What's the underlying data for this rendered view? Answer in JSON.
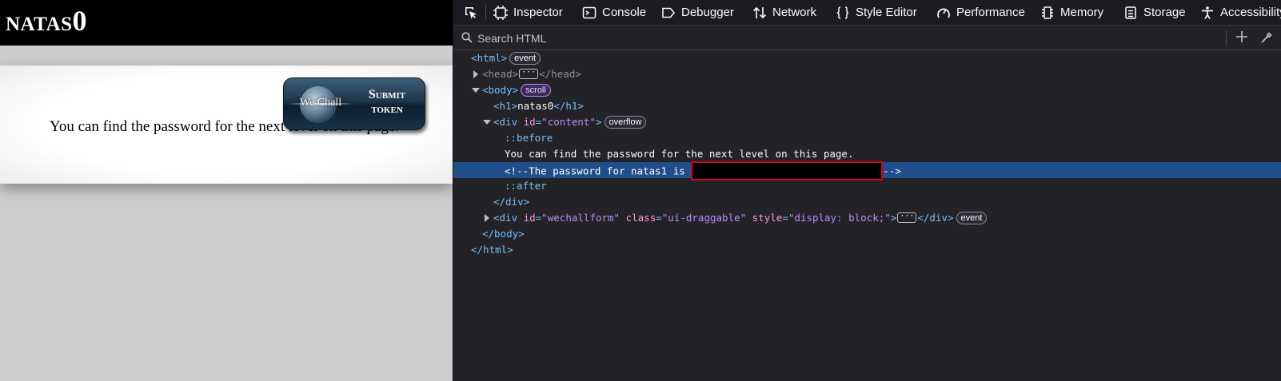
{
  "page": {
    "title": "natas0",
    "content_text": "You can find the password for the next level on this page.",
    "wechall": {
      "logo_text": "We Chall",
      "submit_line1": "Submit",
      "submit_line2": "token"
    }
  },
  "devtools": {
    "tabs": [
      {
        "label": "Inspector",
        "icon": "inspector-icon",
        "active": true
      },
      {
        "label": "Console",
        "icon": "console-icon"
      },
      {
        "label": "Debugger",
        "icon": "debugger-icon"
      },
      {
        "label": "Network",
        "icon": "network-icon"
      },
      {
        "label": "Style Editor",
        "icon": "style-editor-icon"
      },
      {
        "label": "Performance",
        "icon": "performance-icon"
      },
      {
        "label": "Memory",
        "icon": "memory-icon"
      },
      {
        "label": "Storage",
        "icon": "storage-icon"
      },
      {
        "label": "Accessibility",
        "icon": "accessibility-icon"
      }
    ],
    "search": {
      "placeholder": "Search HTML"
    },
    "tree": {
      "html_open": "<html>",
      "html_badge": "event",
      "head_open": "<head>",
      "head_close": "</head>",
      "body_open": "<body>",
      "body_badge": "scroll",
      "h1_open": "<h1>",
      "h1_text": "natas0",
      "h1_close": "</h1>",
      "div_open_start": "<div ",
      "div_id_attr": "id",
      "div_id_val": "\"content\"",
      "div_open_end": ">",
      "div_badge": "overflow",
      "before": "::before",
      "text_node": "You can find the password for the next level on this page.",
      "comment_start": "<!--The password for natas1 is ",
      "comment_end": "-->",
      "after": "::after",
      "div_close": "</div>",
      "wechall_div_start": "<div ",
      "wechall_id_attr": "id",
      "wechall_id_val": "\"wechallform\"",
      "wechall_class_attr": "class",
      "wechall_class_val": "\"ui-draggable\"",
      "wechall_style_attr": "style",
      "wechall_style_val": "\"display: block;\"",
      "wechall_div_end": ">",
      "wechall_div_close": "</div>",
      "wechall_badge": "event",
      "body_close": "</body>",
      "html_close": "</html>",
      "eq": "=",
      "ellipsis": "···"
    },
    "colors": {
      "selected_row": "#204e8a",
      "tag": "#75bfff",
      "attr": "#ff97d3",
      "value": "#b98eff",
      "redaction_border": "#d70022"
    }
  }
}
